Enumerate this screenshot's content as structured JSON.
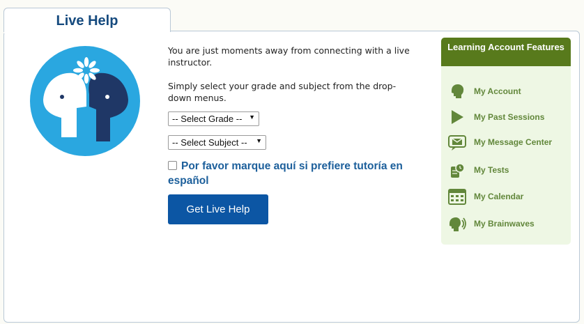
{
  "tab": {
    "title": "Live Help"
  },
  "intro": {
    "line1": "You are just moments away from connecting with a live instructor.",
    "line2": "Simply select your grade and subject from the drop-down menus."
  },
  "form": {
    "grade_select": "-- Select Grade --",
    "subject_select": "-- Select Subject --",
    "spanish_checkbox_label": "Por favor marque aquí si prefiere tutoría en español",
    "submit_label": "Get Live Help"
  },
  "sidebar": {
    "title": "Learning Account Features",
    "items": [
      {
        "label": "My Account",
        "icon": "head-icon"
      },
      {
        "label": "My Past Sessions",
        "icon": "play-icon"
      },
      {
        "label": "My Message Center",
        "icon": "envelope-icon"
      },
      {
        "label": "My Tests",
        "icon": "test-icon"
      },
      {
        "label": "My Calendar",
        "icon": "calendar-icon"
      },
      {
        "label": "My Brainwaves",
        "icon": "brainwaves-icon"
      }
    ]
  },
  "colors": {
    "title": "#154a7e",
    "button": "#0c56a4",
    "sidebar_header": "#587a1c",
    "sidebar_bg": "#eef7e4",
    "sidebar_text": "#62873b",
    "logo_light": "#2aa7e0",
    "logo_dark": "#1f3766"
  }
}
